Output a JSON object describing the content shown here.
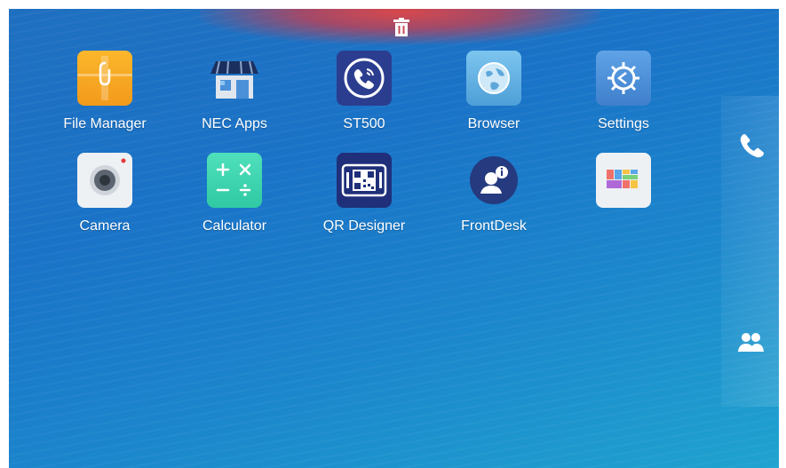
{
  "top_bar": {
    "trash_icon": "trash-icon"
  },
  "apps": [
    {
      "label": "File Manager",
      "icon": "file-manager-icon"
    },
    {
      "label": "NEC Apps",
      "icon": "store-icon"
    },
    {
      "label": "ST500",
      "icon": "phone-circle-icon"
    },
    {
      "label": "Browser",
      "icon": "globe-icon"
    },
    {
      "label": "Settings",
      "icon": "gear-icon"
    },
    {
      "label": "Camera",
      "icon": "camera-icon"
    },
    {
      "label": "Calculator",
      "icon": "calculator-icon"
    },
    {
      "label": "QR Designer",
      "icon": "qr-code-icon"
    },
    {
      "label": "FrontDesk",
      "icon": "frontdesk-icon"
    },
    {
      "label": "",
      "icon": "app-grid-icon"
    }
  ],
  "side_bar": {
    "call_icon": "phone-icon",
    "contacts_icon": "contacts-icon"
  },
  "colors": {
    "background_start": "#1f6fc0",
    "background_end": "#1fa3cf",
    "trash_red": "#e04646",
    "file_manager": "#f5a623",
    "st500": "#2b3d8f",
    "browser": "#5fb3e3",
    "settings": "#4a90d9",
    "calculator": "#3dd6b0",
    "frontdesk": "#2a3f86"
  }
}
